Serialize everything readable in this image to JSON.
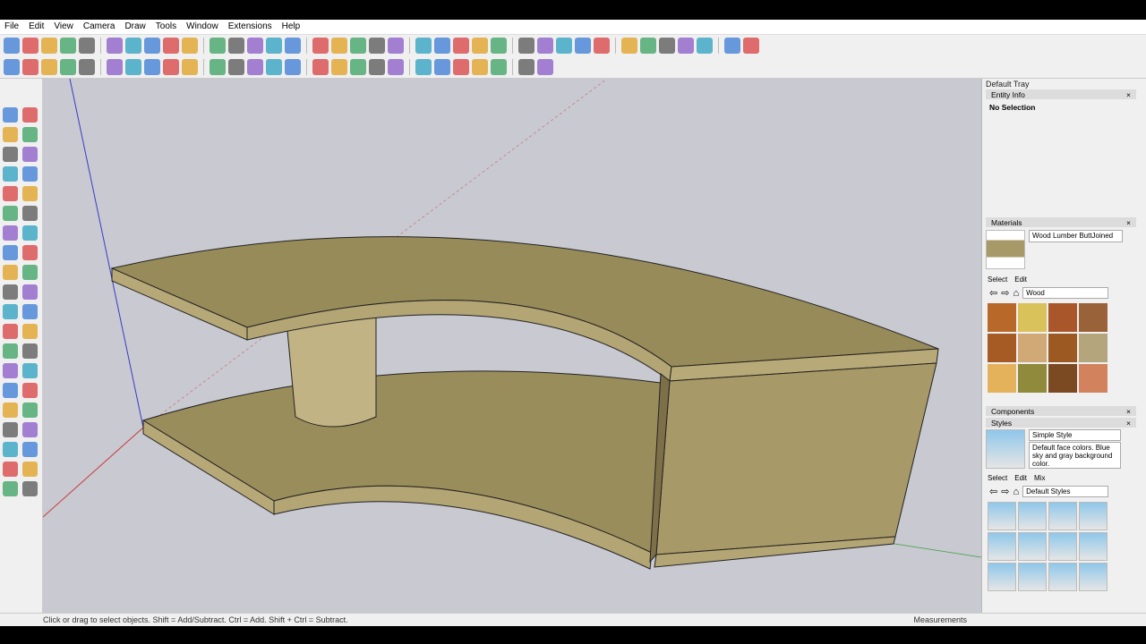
{
  "menu": [
    "File",
    "Edit",
    "View",
    "Camera",
    "Draw",
    "Tools",
    "Window",
    "Extensions",
    "Help"
  ],
  "toolbar1": [
    "select-icon",
    "eraser-icon",
    "pencil-icon",
    "arc-icon",
    "circle-icon",
    "pushpull-icon",
    "followme-icon",
    "move-icon",
    "rotate-icon",
    "scale-icon",
    "tape-icon",
    "text-icon",
    "paint-icon",
    "orbit-icon",
    "pan-icon",
    "zoom-icon",
    "zoom-extents-icon",
    "sandbox-icon",
    "sandbox-smoove-icon",
    "sandbox-stamp-icon",
    "sandbox-drape-icon",
    "section-icon",
    "iso-view-icon",
    "top-view-icon",
    "front-view-icon",
    "right-view-icon",
    "back-view-icon",
    "left-view-icon",
    "xray-icon",
    "wireframe-icon",
    "hidden-line-icon",
    "shaded-icon",
    "textured-icon",
    "monochrome-icon",
    "position-camera-icon",
    "walk-icon",
    "look-around-icon"
  ],
  "toolbar2": [
    "color-by-layer-icon",
    "select-hidden-icon",
    "axes-icon",
    "guide-icon",
    "camera-icon",
    "walk-icon",
    "look-icon",
    "solid-union-icon",
    "solid-trim-icon",
    "solid-split-icon",
    "fog-icon",
    "outer-shell-icon",
    "reload-icon",
    "layers-icon",
    "add-location-icon",
    "terrain-icon",
    "photo-texture-icon",
    "warehouse-icon",
    "extension-icon",
    "mail-icon",
    "info-icon",
    "dynamic-icon",
    "component-icon",
    "interact-icon",
    "options-icon",
    "attributes-icon",
    "share-icon"
  ],
  "lefttools": [
    "select",
    "component",
    "paint",
    "eraser",
    "line",
    "freehand",
    "rectangle",
    "rotated-rect",
    "circle",
    "polygon",
    "arc",
    "two-point-arc",
    "pie",
    "three-point-arc",
    "move",
    "pushpull",
    "rotate",
    "followme",
    "scale",
    "offset",
    "tape",
    "dimension",
    "protractor",
    "text",
    "axes",
    "3dtext",
    "orbit",
    "pan",
    "zoom",
    "zoom-window",
    "zoom-extents",
    "previous",
    "position-camera",
    "look-around",
    "walk",
    "section",
    "sandbox-contours",
    "sandbox-scratch",
    "sandbox-smoove",
    "sandbox-stamp"
  ],
  "tray": {
    "title": "Default Tray",
    "entity_info": {
      "title": "Entity Info",
      "selection": "No Selection"
    },
    "materials": {
      "title": "Materials",
      "name": "Wood Lumber ButtJoined",
      "tabs": [
        "Select",
        "Edit"
      ],
      "library": "Wood",
      "swatches": [
        "#b8692a",
        "#d9c25a",
        "#a9562a",
        "#9a6238",
        "#a65a24",
        "#d0a976",
        "#9c5a22",
        "#b4a57c",
        "#e5b25c",
        "#8f8a3c",
        "#7b4a22",
        "#d2835e"
      ]
    },
    "components": {
      "title": "Components"
    },
    "styles": {
      "title": "Styles",
      "name": "Simple Style",
      "description": "Default face colors. Blue sky and gray background color.",
      "tabs": [
        "Select",
        "Edit",
        "Mix"
      ],
      "library": "Default Styles"
    }
  },
  "status": {
    "hint": "Click or drag to select objects. Shift = Add/Subtract. Ctrl = Add. Shift + Ctrl = Subtract.",
    "measurements": "Measurements"
  },
  "colors": {
    "wood_top": "#988b5a",
    "wood_edge": "#b3a574",
    "wood_box": "#a89a68",
    "sky": "#c8c9d1"
  }
}
